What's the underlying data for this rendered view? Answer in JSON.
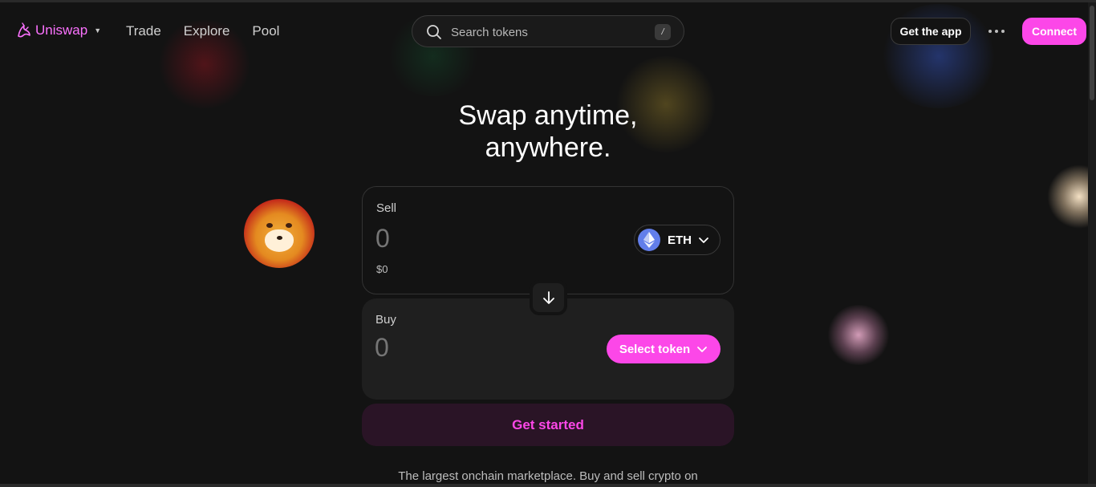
{
  "brand": {
    "name": "Uniswap",
    "caret": "▼",
    "accent": "#fc72ff",
    "button_pink": "#fc47e8"
  },
  "nav": {
    "items": [
      {
        "label": "Trade"
      },
      {
        "label": "Explore"
      },
      {
        "label": "Pool"
      }
    ]
  },
  "search": {
    "placeholder": "Search tokens",
    "shortcut": "/",
    "icon": "search-icon"
  },
  "header_actions": {
    "get_app_label": "Get the app",
    "more_icon": "more-horizontal-icon",
    "connect_label": "Connect"
  },
  "hero": {
    "line1": "Swap anytime,",
    "line2": "anywhere."
  },
  "swap": {
    "sell": {
      "label": "Sell",
      "amount": "0",
      "usd_value": "$0",
      "token": {
        "symbol": "ETH",
        "icon": "eth-icon"
      }
    },
    "buy": {
      "label": "Buy",
      "amount": "0",
      "select_label": "Select token"
    },
    "switch_icon": "arrow-down-icon",
    "cta_label": "Get started"
  },
  "tagline": "The largest onchain marketplace. Buy and sell crypto on"
}
